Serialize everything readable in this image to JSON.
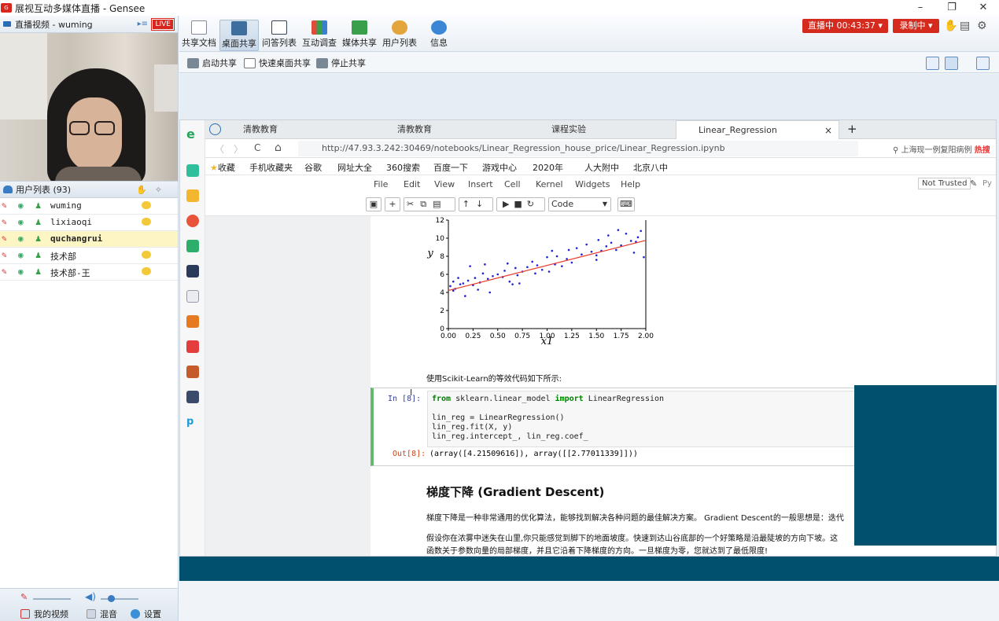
{
  "app": {
    "title": "展视互动多媒体直播 - Gensee",
    "win_minimize": "–",
    "win_restore": "❐",
    "win_close": "✕"
  },
  "video_panel": {
    "header": "直播视频 - wuming",
    "live_badge": "LIVE"
  },
  "users_panel": {
    "header": "用户列表 (93)",
    "users": [
      {
        "name": "wuming",
        "selected": false,
        "chat": true
      },
      {
        "name": "lixiaoqi",
        "selected": false,
        "chat": true
      },
      {
        "name": "quchangrui",
        "selected": true,
        "chat": false
      },
      {
        "name": "技术部",
        "selected": false,
        "chat": true
      },
      {
        "name": "技术部-王",
        "selected": false,
        "chat": true
      }
    ]
  },
  "bottom_bar": {
    "my_video": "我的视频",
    "mix": "混音",
    "settings": "设置"
  },
  "toolbar": {
    "items": [
      {
        "label": "共享文档"
      },
      {
        "label": "桌面共享"
      },
      {
        "label": "问答列表"
      },
      {
        "label": "互动调查"
      },
      {
        "label": "媒体共享"
      },
      {
        "label": "用户列表"
      },
      {
        "label": "信息"
      }
    ],
    "live_status": "直播中 00:43:37 ▾",
    "rec_status": "录制中 ▾"
  },
  "subtoolbar": {
    "start_share": "启动共享",
    "quick_share": "快速桌面共享",
    "stop_share": "停止共享"
  },
  "browser": {
    "tabs": [
      {
        "label": "清教教育",
        "active": false
      },
      {
        "label": "清教教育",
        "active": false
      },
      {
        "label": "课程实验",
        "active": false
      },
      {
        "label": "Linear_Regression",
        "active": true
      }
    ],
    "tab_close": "×",
    "tab_new": "+",
    "nav_back": "〈",
    "nav_forward": "〉",
    "nav_reload": "C",
    "nav_home": "⌂",
    "url": "http://47.93.3.242:30469/notebooks/Linear_Regression_house_price/Linear_Regression.ipynb",
    "search_hint": "上海现一例复阳病例",
    "search_hot": "热搜",
    "bookmarks": [
      "收藏",
      "手机收藏夹",
      "谷歌",
      "网址大全",
      "360搜索",
      "百度一下",
      "游戏中心",
      "2020年",
      "人大附中",
      "北京八中"
    ]
  },
  "jupyter": {
    "menu": [
      "File",
      "Edit",
      "View",
      "Insert",
      "Cell",
      "Kernel",
      "Widgets",
      "Help"
    ],
    "not_trusted": "Not Trusted",
    "kernel_hint": "Py",
    "cell_type": "Code",
    "toolbar_icons": [
      "save-icon",
      "add-icon",
      "cut-icon",
      "copy-icon",
      "paste-icon",
      "up-icon",
      "down-icon",
      "run-icon",
      "stop-icon",
      "restart-icon",
      "keyboard-icon"
    ],
    "md_text_1": "使用Scikit-Learn的等效代码如下所示:",
    "in_prompt": "In  [8]:",
    "out_prompt": "Out[8]:",
    "code_line_1a": "from",
    "code_line_1b": " sklearn.linear_model ",
    "code_line_1c": "import",
    "code_line_1d": " LinearRegression",
    "code_line_2": "lin_reg = LinearRegression()",
    "code_line_3": "lin_reg.fit(X, y)",
    "code_line_4": "lin_reg.intercept_, lin_reg.coef_",
    "output": "(array([4.21509616]), array([[2.77011339]]))",
    "heading": "梯度下降 (Gradient Descent)",
    "para1": "梯度下降是一种非常通用的优化算法，能够找到解决各种问题的最佳解决方案。 Gradient Descent的一般思想是：迭代",
    "para2a": "假设你在浓雾中迷失在山里,你只能感觉到脚下的地面坡度。快速到达山谷底部的一个好策略是沿最陡坡的方向下坡。这",
    "para2b": "函数关于参数向量的局部梯度，并且它沿着下降梯度的方向。一旦梯度为零，您就达到了最低限度!"
  },
  "chart_data": {
    "type": "scatter",
    "xlabel": "x1",
    "ylabel": "y",
    "xlim": [
      0,
      2
    ],
    "ylim": [
      0,
      12
    ],
    "xticks": [
      "0.00",
      "0.25",
      "0.50",
      "0.75",
      "1.00",
      "1.25",
      "1.50",
      "1.75",
      "2.00"
    ],
    "yticks": [
      "0",
      "2",
      "4",
      "6",
      "8",
      "10",
      "12"
    ],
    "point_color": "#1f1fd6",
    "line_color": "#e8392b",
    "fit_line": {
      "intercept": 4.215,
      "slope": 2.77
    },
    "points": [
      [
        0.02,
        4.7
      ],
      [
        0.05,
        5.2
      ],
      [
        0.07,
        4.4
      ],
      [
        0.1,
        5.6
      ],
      [
        0.12,
        4.9
      ],
      [
        0.15,
        5.0
      ],
      [
        0.17,
        3.6
      ],
      [
        0.2,
        5.3
      ],
      [
        0.22,
        6.9
      ],
      [
        0.25,
        4.8
      ],
      [
        0.27,
        5.6
      ],
      [
        0.3,
        4.3
      ],
      [
        0.32,
        5.1
      ],
      [
        0.35,
        6.1
      ],
      [
        0.37,
        7.1
      ],
      [
        0.4,
        5.5
      ],
      [
        0.42,
        4.0
      ],
      [
        0.45,
        5.8
      ],
      [
        0.5,
        6.0
      ],
      [
        0.55,
        5.7
      ],
      [
        0.57,
        6.4
      ],
      [
        0.6,
        7.2
      ],
      [
        0.62,
        5.2
      ],
      [
        0.65,
        4.9
      ],
      [
        0.68,
        6.7
      ],
      [
        0.7,
        5.9
      ],
      [
        0.72,
        5.0
      ],
      [
        0.75,
        6.3
      ],
      [
        0.8,
        6.8
      ],
      [
        0.85,
        7.4
      ],
      [
        0.88,
        6.1
      ],
      [
        0.9,
        7.0
      ],
      [
        0.95,
        6.5
      ],
      [
        1.0,
        7.9
      ],
      [
        1.02,
        6.3
      ],
      [
        1.05,
        8.6
      ],
      [
        1.08,
        7.1
      ],
      [
        1.1,
        8.0
      ],
      [
        1.15,
        6.9
      ],
      [
        1.2,
        7.7
      ],
      [
        1.22,
        8.7
      ],
      [
        1.25,
        7.3
      ],
      [
        1.3,
        8.9
      ],
      [
        1.35,
        8.2
      ],
      [
        1.4,
        9.3
      ],
      [
        1.45,
        8.5
      ],
      [
        1.5,
        8.1
      ],
      [
        1.52,
        9.8
      ],
      [
        1.55,
        8.6
      ],
      [
        1.6,
        9.1
      ],
      [
        1.62,
        10.3
      ],
      [
        1.65,
        9.5
      ],
      [
        1.7,
        8.7
      ],
      [
        1.72,
        10.9
      ],
      [
        1.75,
        9.2
      ],
      [
        1.8,
        10.5
      ],
      [
        1.85,
        9.7
      ],
      [
        1.88,
        8.4
      ],
      [
        1.9,
        9.6
      ],
      [
        1.92,
        10.1
      ],
      [
        1.95,
        10.8
      ],
      [
        1.98,
        7.9
      ],
      [
        1.5,
        7.6
      ],
      [
        0.05,
        4.2
      ]
    ]
  }
}
